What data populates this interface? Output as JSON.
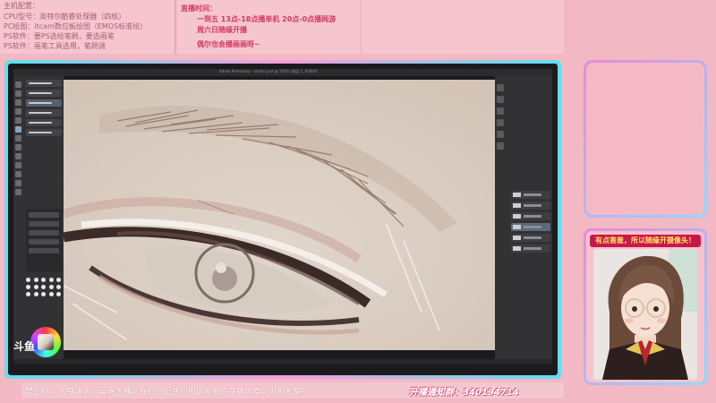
{
  "top_left": {
    "lines": [
      "主机配置：",
      "CPU型号：英特尔酷睿处理器（四核）",
      "PC绘图：itcam数位板绘图（EMOS标准绘）",
      "PS软件：要PS选绘笔刷，要选画笔",
      "PS软件：画笔工具选用，笔刷调"
    ]
  },
  "top_mid": {
    "title": "直播时间：",
    "schedule": [
      "一到五 13点-18点播单机 20点-0点播网游",
      "周六日随缘开播",
      "偶尔也会播画画呀~"
    ]
  },
  "screen": {
    "window_title": "Adobe Photoshop - sketch.psd @ 100% (图层 1, RGB/8)",
    "logo": "斗鱼"
  },
  "camera": {
    "banner": "有点害羞，所以随缘开摄像头！"
  },
  "bottom": {
    "notice": "禁止ky、人身攻击、辱骂主播，我们一起共创和谐友爱的直播环境，谢谢大家！",
    "fanclub": "开播通知群：340194714"
  },
  "colors": {
    "background": "#f2b8c4",
    "frame_cyan": "#5ee0f0",
    "frame_pink": "#f59fd9",
    "accent_red": "#c8184a",
    "accent_yellow": "#ffe067"
  },
  "icons": [
    "photoshop-tool-icon",
    "color-wheel-icon",
    "layer-thumbnail-icon"
  ]
}
